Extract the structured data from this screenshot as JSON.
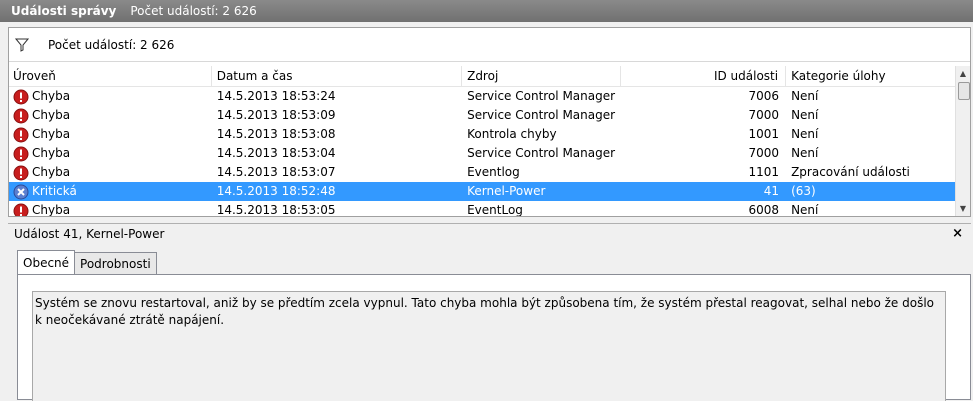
{
  "titlebar": {
    "title": "Události správy",
    "count": "Počet událostí: 2 626"
  },
  "filter": {
    "icon": "filter-icon",
    "label": "Počet událostí: 2 626"
  },
  "columns": [
    "Úroveň",
    "Datum a čas",
    "Zdroj",
    "ID události",
    "Kategorie úlohy"
  ],
  "rows": [
    {
      "level": "Chyba",
      "icon": "error-icon",
      "date": "14.5.2013 18:53:24",
      "source": "Service Control Manager",
      "id": "7006",
      "category": "Není"
    },
    {
      "level": "Chyba",
      "icon": "error-icon",
      "date": "14.5.2013 18:53:09",
      "source": "Service Control Manager",
      "id": "7000",
      "category": "Není"
    },
    {
      "level": "Chyba",
      "icon": "error-icon",
      "date": "14.5.2013 18:53:08",
      "source": "Kontrola chyby",
      "id": "1001",
      "category": "Není"
    },
    {
      "level": "Chyba",
      "icon": "error-icon",
      "date": "14.5.2013 18:53:04",
      "source": "Service Control Manager",
      "id": "7000",
      "category": "Není"
    },
    {
      "level": "Chyba",
      "icon": "error-icon",
      "date": "14.5.2013 18:53:07",
      "source": "Eventlog",
      "id": "1101",
      "category": "Zpracování události"
    },
    {
      "level": "Kritická",
      "icon": "critical-icon",
      "date": "14.5.2013 18:52:48",
      "source": "Kernel-Power",
      "id": "41",
      "category": "(63)",
      "selected": true
    },
    {
      "level": "Chyba",
      "icon": "error-icon",
      "date": "14.5.2013 18:53:05",
      "source": "EventLog",
      "id": "6008",
      "category": "Není"
    }
  ],
  "detail": {
    "header": "Událost 41, Kernel-Power",
    "close": "×",
    "tabs": [
      "Obecné",
      "Podrobnosti"
    ],
    "description": "Systém se znovu restartoval, aniž by se předtím zcela vypnul. Tato chyba mohla být způsobena tím, že systém přestal reagovat, selhal nebo že došlo k neočekávané ztrátě napájení."
  },
  "colors": {
    "selection": "#3399ff",
    "error": "#c81e1e",
    "critical": "#5b7fd0"
  }
}
